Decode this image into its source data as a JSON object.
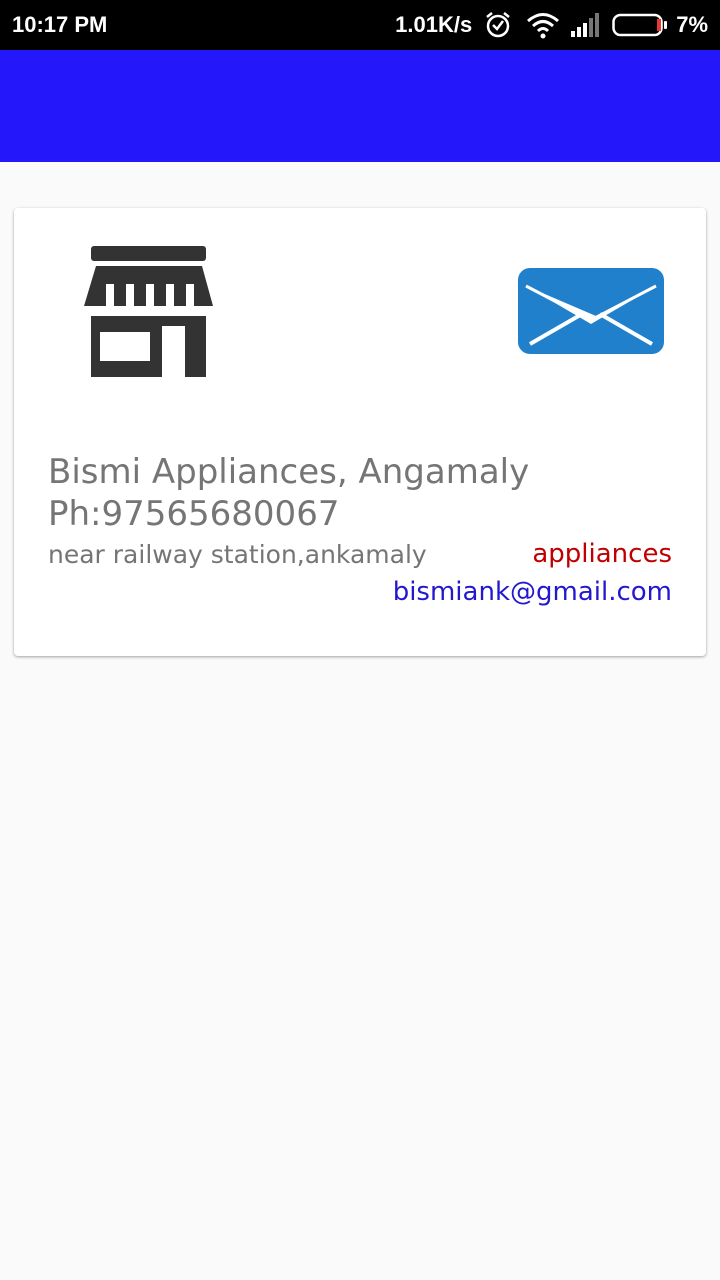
{
  "status_bar": {
    "time": "10:17 PM",
    "net_speed": "1.01K/s",
    "battery": "7%"
  },
  "colors": {
    "app_bar": "#2418fb",
    "category": "#c00000",
    "email": "#2418cf",
    "mail_icon": "#2180cc"
  },
  "listing": {
    "name": "Bismi Appliances, Angamaly",
    "phone": "Ph:97565680067",
    "address": "near railway station,ankamaly",
    "category": "appliances",
    "email": "bismiank@gmail.com",
    "store_icon": "store-icon",
    "email_icon": "mail-icon"
  }
}
